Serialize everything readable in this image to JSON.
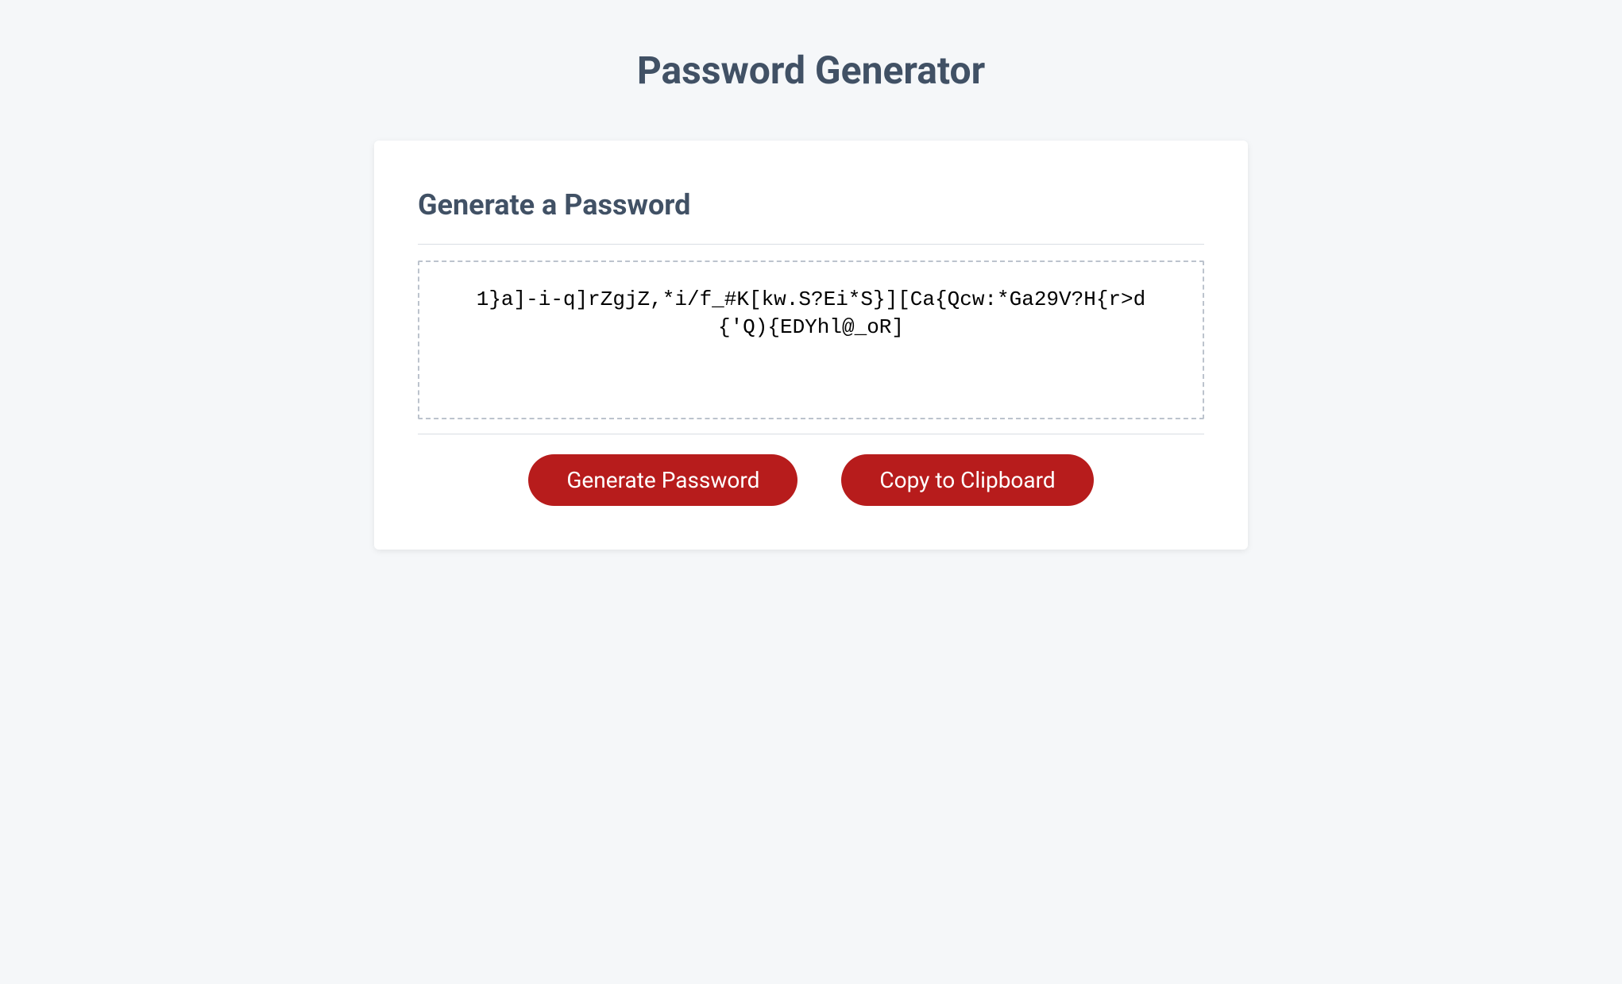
{
  "page": {
    "title": "Password Generator"
  },
  "card": {
    "heading": "Generate a Password",
    "password_output": "1}a]-i-q]rZgjZ,*i/f_#K[kw.S?Ei*S}][Ca{Qcw:*Ga29V?H{r>d{'Q){EDYhl@_oR]"
  },
  "buttons": {
    "generate_label": "Generate Password",
    "copy_label": "Copy to Clipboard"
  }
}
